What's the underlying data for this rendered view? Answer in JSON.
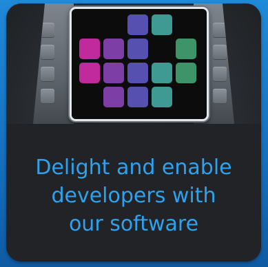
{
  "tagline": {
    "line1": "Delight and enable",
    "line2": "developers with",
    "line3": "our software"
  },
  "colors": {
    "background": "#1a7fd0",
    "card": "#24272b",
    "text_panel": "#212326",
    "tagline_text": "#2da3f0",
    "screen_border": "#e6e9ec",
    "tile_magenta": "#c02a9c",
    "tile_purple": "#7d3ea6",
    "tile_blue": "#5651b0",
    "tile_teal": "#3f9a93",
    "tile_green": "#3d9469"
  },
  "illustration": {
    "icon": "server-with-screen-icon",
    "tile_grid": [
      [
        "",
        "",
        "blue",
        "teal",
        ""
      ],
      [
        "magenta",
        "purple",
        "blue",
        "",
        "green"
      ],
      [
        "magenta",
        "purple",
        "blue",
        "teal",
        "green"
      ],
      [
        "",
        "purple",
        "blue",
        "teal",
        ""
      ]
    ]
  }
}
